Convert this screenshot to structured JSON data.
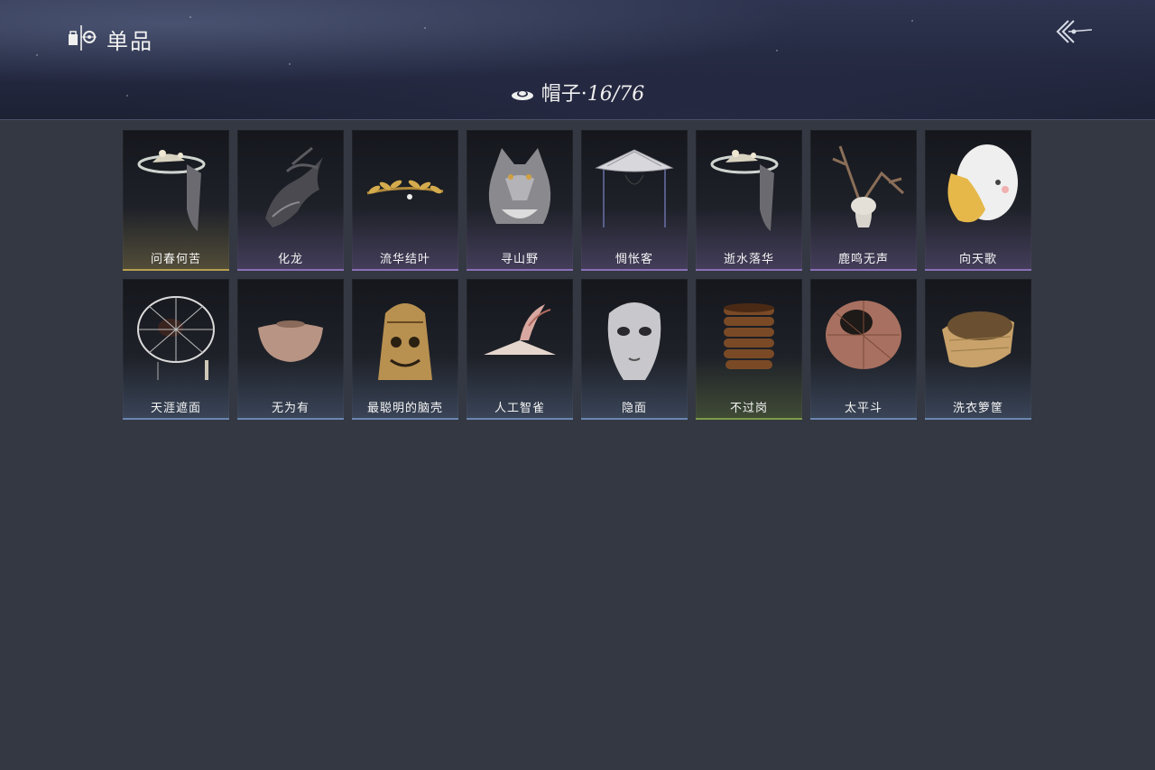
{
  "header": {
    "title": "单品",
    "category_icon": "hat-icon",
    "category_label": "帽子·",
    "category_count": "16/76",
    "back_icon": "back-arrow-icon"
  },
  "colors": {
    "gold": "#b8a050",
    "purple": "#8a70b8",
    "blue": "#6a86b0",
    "green": "#7e9a48"
  },
  "items": [
    {
      "name": "问春何苦",
      "rarity": "gold",
      "icon": "veiled-hat-icon"
    },
    {
      "name": "化龙",
      "rarity": "purple",
      "icon": "dragon-headpiece-icon"
    },
    {
      "name": "流华结叶",
      "rarity": "purple",
      "icon": "laurel-crown-icon"
    },
    {
      "name": "寻山野",
      "rarity": "purple",
      "icon": "wolf-head-icon"
    },
    {
      "name": "惆怅客",
      "rarity": "purple",
      "icon": "bamboo-hat-icon"
    },
    {
      "name": "逝水落华",
      "rarity": "purple",
      "icon": "veiled-hat-icon"
    },
    {
      "name": "鹿鸣无声",
      "rarity": "purple",
      "icon": "deer-skull-icon"
    },
    {
      "name": "向天歌",
      "rarity": "purple",
      "icon": "duck-hood-icon"
    },
    {
      "name": "天涯遮面",
      "rarity": "blue",
      "icon": "wire-hat-icon"
    },
    {
      "name": "无为有",
      "rarity": "blue",
      "icon": "clay-bowl-icon"
    },
    {
      "name": "最聪明的脑壳",
      "rarity": "blue",
      "icon": "bell-helmet-icon"
    },
    {
      "name": "人工智雀",
      "rarity": "blue",
      "icon": "bird-hat-icon"
    },
    {
      "name": "隐面",
      "rarity": "blue",
      "icon": "silver-mask-icon"
    },
    {
      "name": "不过岗",
      "rarity": "green",
      "icon": "bowl-stack-icon"
    },
    {
      "name": "太平斗",
      "rarity": "blue",
      "icon": "woven-basket-icon"
    },
    {
      "name": "洗衣箩筐",
      "rarity": "blue",
      "icon": "laundry-basket-icon"
    }
  ]
}
